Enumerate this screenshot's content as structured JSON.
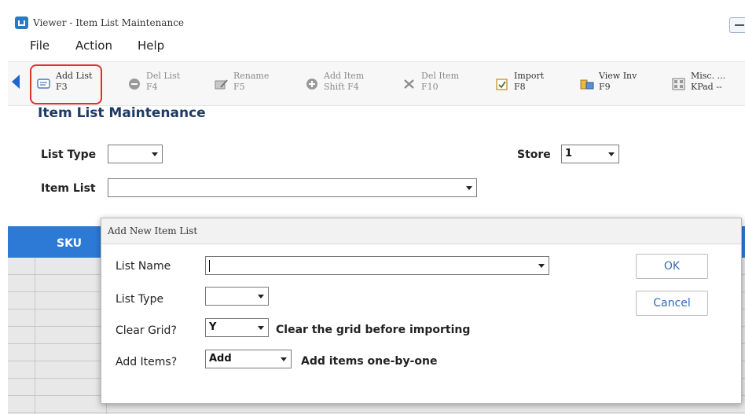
{
  "window": {
    "title": "Viewer - Item List Maintenance"
  },
  "menu": [
    "File",
    "Action",
    "Help"
  ],
  "toolbar": {
    "buttons": [
      {
        "label": "Add List",
        "key": "F3",
        "icon": "list-add-icon"
      },
      {
        "label": "Del List",
        "key": "F4",
        "icon": "minus-circle-icon"
      },
      {
        "label": "Rename",
        "key": "F5",
        "icon": "rename-icon"
      },
      {
        "label": "Add Item",
        "key": "Shift F4",
        "icon": "plus-circle-icon"
      },
      {
        "label": "Del Item",
        "key": "F10",
        "icon": "x-icon"
      },
      {
        "label": "Import",
        "key": "F8",
        "icon": "import-icon"
      },
      {
        "label": "View Inv",
        "key": "F9",
        "icon": "inventory-icon"
      },
      {
        "label": "Misc. ...",
        "key": "KPad --",
        "icon": "keypad-icon"
      }
    ]
  },
  "main": {
    "title": "Item List Maintenance",
    "list_type_label": "List Type",
    "list_type_value": "",
    "store_label": "Store",
    "store_value": "1",
    "item_list_label": "Item List",
    "item_list_value": ""
  },
  "grid": {
    "columns": [
      "SKU"
    ]
  },
  "dialog": {
    "title": "Add New Item List",
    "list_name_label": "List Name",
    "list_name_value": "",
    "list_type_label": "List Type",
    "list_type_value": "",
    "clear_grid_label": "Clear Grid?",
    "clear_grid_value": "Y",
    "clear_grid_desc": "Clear the grid before importing",
    "add_items_label": "Add Items?",
    "add_items_value": "Add",
    "add_items_desc": "Add items one-by-one",
    "ok_label": "OK",
    "cancel_label": "Cancel"
  }
}
